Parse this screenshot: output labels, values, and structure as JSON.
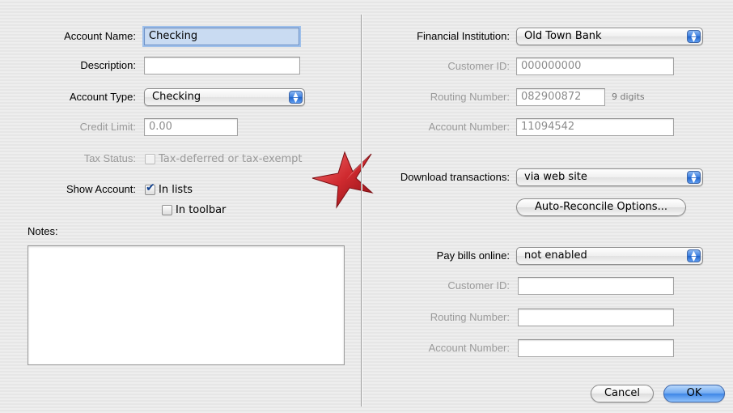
{
  "left": {
    "account_name": {
      "label": "Account Name:",
      "value": "Checking"
    },
    "description": {
      "label": "Description:",
      "value": ""
    },
    "account_type": {
      "label": "Account Type:",
      "value": "Checking"
    },
    "credit_limit": {
      "label": "Credit Limit:",
      "value": "0.00"
    },
    "tax_status": {
      "label": "Tax Status:",
      "option": "Tax-deferred or tax-exempt"
    },
    "show_account": {
      "label": "Show Account:",
      "in_lists": "In lists",
      "in_toolbar": "In toolbar"
    },
    "notes": {
      "label": "Notes:",
      "value": ""
    }
  },
  "right": {
    "financial_institution": {
      "label": "Financial Institution:",
      "value": "Old Town Bank"
    },
    "customer_id": {
      "label": "Customer ID:",
      "value": "000000000"
    },
    "routing_number": {
      "label": "Routing Number:",
      "value": "082900872",
      "hint": "9 digits"
    },
    "account_number": {
      "label": "Account Number:",
      "value": "11094542"
    },
    "download_transactions": {
      "label": "Download transactions:",
      "value": "via web site"
    },
    "auto_reconcile_button": "Auto-Reconcile Options...",
    "pay_bills": {
      "label": "Pay bills online:",
      "value": "not enabled"
    },
    "bill_customer_id": {
      "label": "Customer ID:",
      "value": ""
    },
    "bill_routing_number": {
      "label": "Routing Number:",
      "value": ""
    },
    "bill_account_number": {
      "label": "Account Number:",
      "value": ""
    }
  },
  "buttons": {
    "cancel": "Cancel",
    "ok": "OK"
  },
  "colors": {
    "star": "#c8232c",
    "default_button": "#3e86e6",
    "focus_field": "#c9dbf2"
  }
}
